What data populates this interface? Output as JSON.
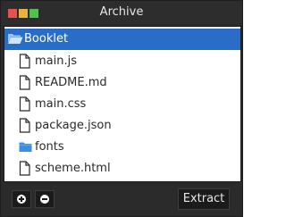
{
  "window": {
    "title": "Archive"
  },
  "tree": {
    "root": {
      "label": "Booklet",
      "icon": "folder-open-icon"
    },
    "items": [
      {
        "label": "main.js",
        "icon": "file-icon"
      },
      {
        "label": "README.md",
        "icon": "file-icon"
      },
      {
        "label": "main.css",
        "icon": "file-icon"
      },
      {
        "label": "package.json",
        "icon": "file-icon"
      },
      {
        "label": "fonts",
        "icon": "folder-icon"
      },
      {
        "label": "scheme.html",
        "icon": "file-icon"
      }
    ]
  },
  "toolbar": {
    "add_icon": "plus-circle-icon",
    "remove_icon": "minus-circle-icon",
    "extract_label": "Extract"
  },
  "colors": {
    "selection": "#2a6dc9",
    "folder": "#3d8ee6",
    "window_bg": "#2b2b2b"
  }
}
